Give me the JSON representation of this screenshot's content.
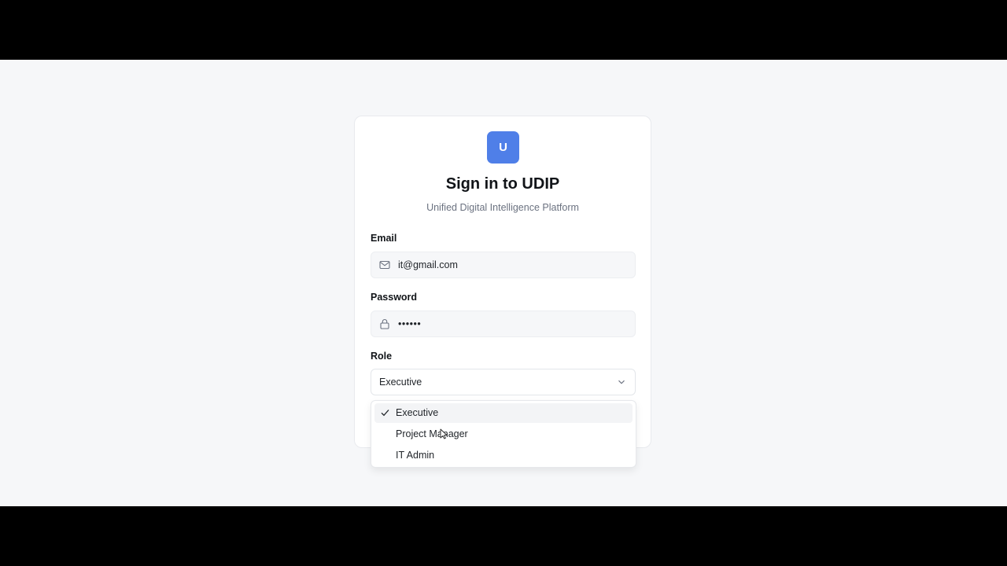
{
  "brand": {
    "logo_letter": "U",
    "logo_color": "#4f7fe8"
  },
  "header": {
    "title": "Sign in to UDIP",
    "subtitle": "Unified Digital Intelligence Platform"
  },
  "form": {
    "email": {
      "label": "Email",
      "value": "it@gmail.com",
      "icon": "mail-icon"
    },
    "password": {
      "label": "Password",
      "value": "••••••",
      "icon": "lock-icon"
    },
    "role": {
      "label": "Role",
      "selected": "Executive",
      "options": [
        {
          "label": "Executive",
          "selected": true
        },
        {
          "label": "Project Manager",
          "selected": false
        },
        {
          "label": "IT Admin",
          "selected": false
        }
      ]
    }
  }
}
